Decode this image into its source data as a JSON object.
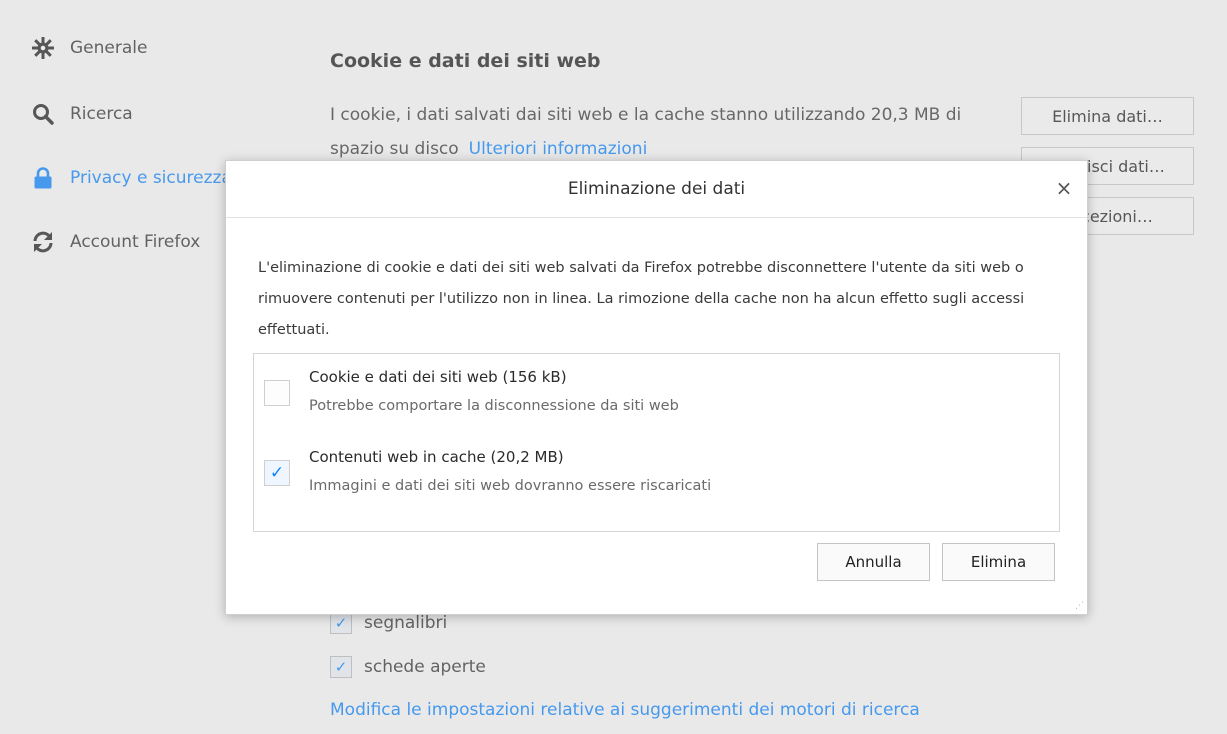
{
  "sidebar": {
    "items": [
      {
        "label": "Generale",
        "icon": "gear-icon"
      },
      {
        "label": "Ricerca",
        "icon": "search-icon"
      },
      {
        "label": "Privacy e sicurezza",
        "icon": "lock-icon",
        "active": true
      },
      {
        "label": "Account Firefox",
        "icon": "sync-icon"
      }
    ]
  },
  "main": {
    "section_title": "Cookie e dati dei siti web",
    "section_text": "I cookie, i dati salvati dai siti web e la cache stanno utilizzando 20,3 MB di spazio su disco",
    "more_info_link": "Ulteriori informazioni",
    "buttons": {
      "delete_data": "Elimina dati…",
      "manage_data": "Gestisci dati…",
      "exceptions": "Eccezioni…"
    },
    "bg_options": [
      {
        "label": "segnalibri",
        "checked": true
      },
      {
        "label": "schede aperte",
        "checked": true
      }
    ],
    "bottom_link": "Modifica le impostazioni relative ai suggerimenti dei motori di ricerca"
  },
  "dialog": {
    "title": "Eliminazione dei dati",
    "close_glyph": "×",
    "description": "L'eliminazione di cookie e dati dei siti web salvati da Firefox potrebbe disconnettere l'utente da siti web o rimuovere contenuti per l'utilizzo non in linea. La rimozione della cache non ha alcun effetto sugli accessi effettuati.",
    "options": [
      {
        "label": "Cookie e dati dei siti web (156 kB)",
        "sub": "Potrebbe comportare la disconnessione da siti web",
        "checked": false
      },
      {
        "label": "Contenuti web in cache (20,2 MB)",
        "sub": "Immagini e dati dei siti web dovranno essere riscaricati",
        "checked": true
      }
    ],
    "cancel_label": "Annulla",
    "confirm_label": "Elimina"
  },
  "colors": {
    "accent": "#0a84ff"
  }
}
